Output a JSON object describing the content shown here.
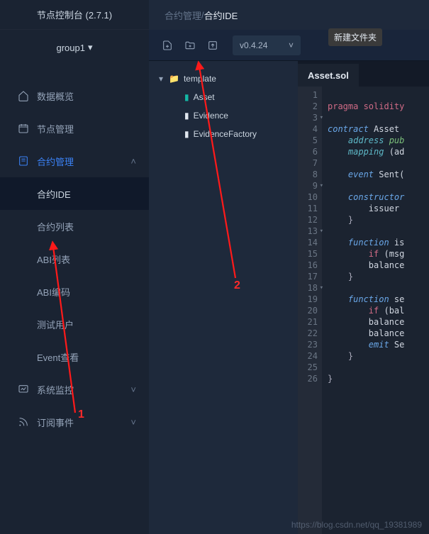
{
  "sidebar": {
    "title": "节点控制台 (2.7.1)",
    "group": "group1",
    "items": [
      {
        "label": "数据概览"
      },
      {
        "label": "节点管理"
      },
      {
        "label": "合约管理"
      },
      {
        "label": "系统监控"
      },
      {
        "label": "订阅事件"
      }
    ],
    "contract_sub": [
      {
        "label": "合约IDE"
      },
      {
        "label": "合约列表"
      },
      {
        "label": "ABI列表"
      },
      {
        "label": "ABI编码"
      },
      {
        "label": "测试用户"
      },
      {
        "label": "Event查看"
      }
    ]
  },
  "breadcrumb": {
    "parent": "合约管理",
    "sep": "  /  ",
    "current": "合约IDE"
  },
  "tooltip": {
    "new_folder": "新建文件夹"
  },
  "version": {
    "label": "v0.4.24"
  },
  "tree": {
    "root": "template",
    "files": [
      "Asset",
      "Evidence",
      "EvidenceFactory"
    ]
  },
  "editor": {
    "tab": "Asset.sol",
    "lines_total": 26
  },
  "code": {
    "l1": {
      "a": "pragma",
      "b": " solidity"
    },
    "l3": {
      "a": "contract",
      "b": " Asset "
    },
    "l4": {
      "a": "    address",
      "b": " pub"
    },
    "l5": {
      "a": "    mapping",
      "b": " (ad"
    },
    "l7": {
      "a": "    event",
      "b": " Sent("
    },
    "l9": {
      "a": "    constructor"
    },
    "l10": "        issuer ",
    "l11": "    }",
    "l13": {
      "a": "    function",
      "b": " is"
    },
    "l14": {
      "a": "        if",
      "b": " (msg"
    },
    "l15": "        balance",
    "l16": "    }",
    "l18": {
      "a": "    function",
      "b": " se"
    },
    "l19": {
      "a": "        if",
      "b": " (bal"
    },
    "l20": "        balance",
    "l21": "        balance",
    "l22": {
      "a": "        emit",
      "b": " Se"
    },
    "l23": "    }",
    "l25": "}"
  },
  "annot": {
    "one": "1",
    "two": "2"
  },
  "watermark": "https://blog.csdn.net/qq_19381989"
}
